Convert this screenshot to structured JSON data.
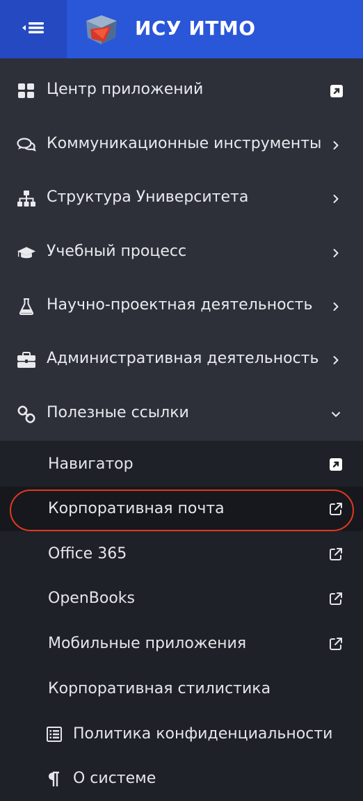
{
  "header": {
    "title": "ИСУ ИТМО",
    "toggle_icon": "collapse-menu-icon",
    "logo_icon": "itmo-cube-logo"
  },
  "colors": {
    "header_bg": "#2a56d8",
    "toggle_bg": "#2449c1",
    "menu_bg": "#2d3039",
    "submenu_bg": "#1f2128",
    "active_bg": "#17181d",
    "highlight": "#e0391f"
  },
  "menu": {
    "items": [
      {
        "label": "Центр приложений",
        "icon": "grid-icon",
        "trailing": "external-link-solid-icon"
      },
      {
        "label": "Коммуникационные инструменты",
        "icon": "chat-icon",
        "trailing": "chevron-right-icon"
      },
      {
        "label": "Структура Университета",
        "icon": "sitemap-icon",
        "trailing": "chevron-right-icon"
      },
      {
        "label": "Учебный процесс",
        "icon": "graduation-cap-icon",
        "trailing": "chevron-right-icon"
      },
      {
        "label": "Научно-проектная деятельность",
        "icon": "flask-icon",
        "trailing": "chevron-right-icon"
      },
      {
        "label": "Административная деятельность",
        "icon": "briefcase-icon",
        "trailing": "chevron-right-icon"
      },
      {
        "label": "Полезные ссылки",
        "icon": "link-icon",
        "trailing": "chevron-down-icon"
      }
    ]
  },
  "submenu": {
    "items": [
      {
        "label": "Навигатор",
        "trailing": "external-link-solid-icon"
      },
      {
        "label": "Корпоративная почта",
        "trailing": "external-link-icon",
        "active": true
      },
      {
        "label": "Office 365",
        "trailing": "external-link-icon"
      },
      {
        "label": "OpenBooks",
        "trailing": "external-link-icon"
      },
      {
        "label": "Мобильные приложения",
        "trailing": "external-link-icon"
      },
      {
        "label": "Корпоративная стилистика",
        "trailing": ""
      },
      {
        "label": "Политика конфиденциальности",
        "icon": "document-list-icon",
        "trailing": ""
      },
      {
        "label": "О системе",
        "icon": "pilcrow-icon",
        "trailing": ""
      }
    ]
  }
}
